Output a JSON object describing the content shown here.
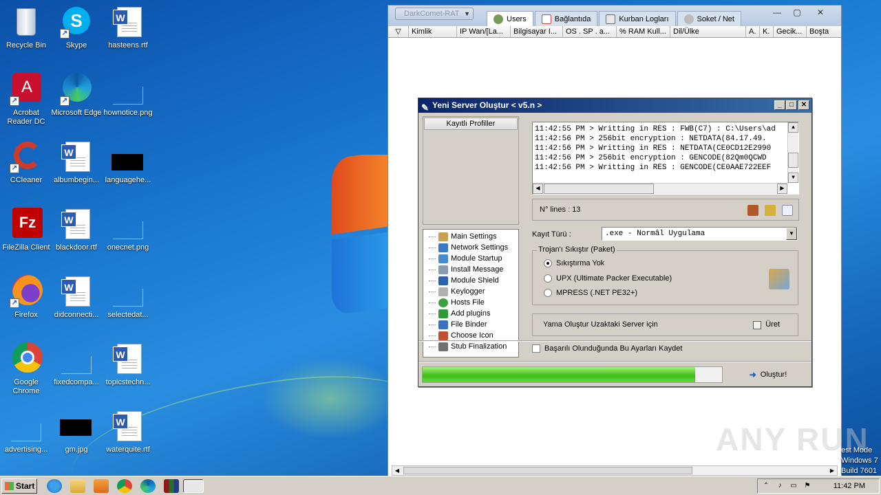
{
  "desktop": {
    "icons": [
      {
        "label": "Recycle Bin"
      },
      {
        "label": "Skype"
      },
      {
        "label": "hasteens.rtf"
      },
      {
        "label": "Acrobat Reader DC"
      },
      {
        "label": "Microsoft Edge"
      },
      {
        "label": "hownotice.png"
      },
      {
        "label": "CCleaner"
      },
      {
        "label": "albumbegin..."
      },
      {
        "label": "languagehe..."
      },
      {
        "label": "FileZilla Client"
      },
      {
        "label": "blackdoor.rtf"
      },
      {
        "label": "onecnet.png"
      },
      {
        "label": "Firefox"
      },
      {
        "label": "didconnecti..."
      },
      {
        "label": "selectedat..."
      },
      {
        "label": "Google Chrome"
      },
      {
        "label": "fixedcompa..."
      },
      {
        "label": "topicstechn..."
      },
      {
        "label": "advertising..."
      },
      {
        "label": "gm.jpg"
      },
      {
        "label": "waterquite.rtf"
      }
    ],
    "build_lines": [
      "est Mode",
      "Windows 7",
      "Build 7601"
    ],
    "watermark": "ANY RUN"
  },
  "darkcomet": {
    "dropdown": "DarkComet-RAT",
    "tabs": [
      {
        "label": "Users",
        "icon": "users-icon"
      },
      {
        "label": "Bağlantıda",
        "icon": "calendar-icon"
      },
      {
        "label": "Kurban Logları",
        "icon": "log-icon"
      },
      {
        "label": "Soket / Net",
        "icon": "socket-icon"
      }
    ],
    "columns": [
      "Kimlik",
      "IP Wan/[La...",
      "Bilgisayar I...",
      "OS . SP . a...",
      "% RAM Kull...",
      "Dil/Ülke",
      "A.",
      "K.",
      "Gecik...",
      "Boşta"
    ]
  },
  "dialog": {
    "title": "Yeni Server Oluştur < v5.n >",
    "profiles_header": "Kayıtlı Profiller",
    "tree": [
      {
        "label": "Main Settings",
        "color": "#c9a050"
      },
      {
        "label": "Network Settings",
        "color": "#3b78c8"
      },
      {
        "label": "Module Startup",
        "color": "#4a8ad0"
      },
      {
        "label": "Install Message",
        "color": "#8a9ab0"
      },
      {
        "label": "Module Shield",
        "color": "#3060b0"
      },
      {
        "label": "Keylogger",
        "color": "#b0b0b0"
      },
      {
        "label": "Hosts File",
        "color": "#3aa040"
      },
      {
        "label": "Add plugins",
        "color": "#2f9a3a"
      },
      {
        "label": "File Binder",
        "color": "#3a70c0"
      },
      {
        "label": "Choose Icon",
        "color": "#c05030"
      },
      {
        "label": "Stub Finalization",
        "color": "#707070"
      }
    ],
    "log_lines": [
      "11:42:55 PM > Writting in RES : FWB(C7) : C:\\Users\\ad",
      "11:42:56 PM > 256bit encryption :  NETDATA(84.17.49.",
      "11:42:56 PM > Writting in RES : NETDATA(CE0CD12E2990",
      "11:42:56 PM > 256bit encryption :  GENCODE(82Qm0QCWD",
      "11:42:56 PM > Writting in RES : GENCODE(CE0AAE722EEF"
    ],
    "lines_label": "N° lines : 13",
    "kayit_label": "Kayıt Türü :",
    "kayit_value": ".exe - Normâl Uygulama",
    "pack_legend": "Trojan'ı Sıkıştır (Paket)",
    "pack_options": [
      "Sıkıştırma Yok",
      "UPX (Ultimate Packer Executable)",
      "MPRESS (.NET PE32+)"
    ],
    "pack_selected": 0,
    "yama_label": "Yama Oluştur Uzaktaki Server için",
    "uret_label": "Üret",
    "save_checkbox": "Başarılı Olunduğunda Bu Ayarları Kaydet",
    "progress_fraction": 0.91,
    "create_label": "Oluştur!"
  },
  "taskbar": {
    "start": "Start",
    "clock": "11:42 PM"
  }
}
